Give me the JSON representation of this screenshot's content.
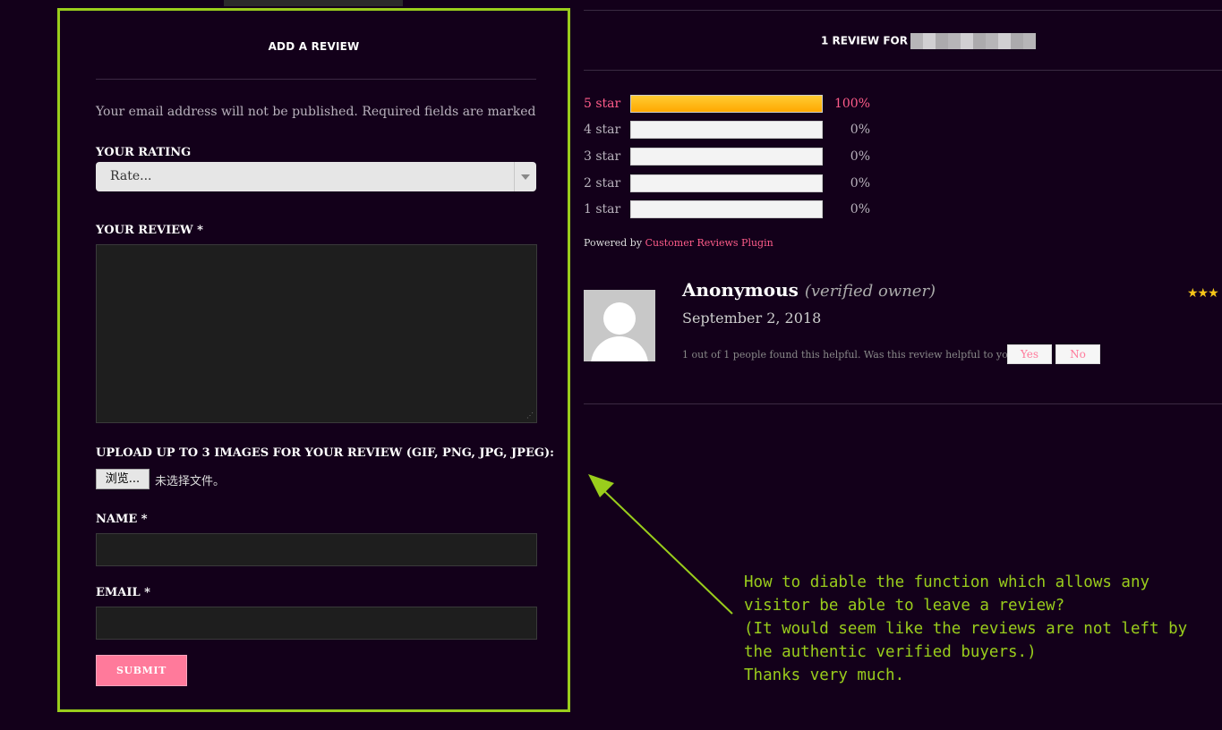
{
  "form": {
    "title": "ADD A REVIEW",
    "note": "Your email address will not be published. Required fields are marked",
    "rating_label": "YOUR RATING",
    "rating_value": "Rate...",
    "review_label": "YOUR REVIEW *",
    "upload_label": "UPLOAD UP TO 3 IMAGES FOR YOUR REVIEW (GIF, PNG, JPG, JPEG):",
    "browse_label": "浏览...",
    "file_status": "未选择文件。",
    "name_label": "NAME *",
    "email_label": "EMAIL *",
    "submit_label": "SUBMIT"
  },
  "summary": {
    "count_text": "1 REVIEW FOR",
    "histogram": [
      {
        "label": "5 star",
        "percent": "100%",
        "fill": 1.0,
        "active": true
      },
      {
        "label": "4 star",
        "percent": "0%",
        "fill": 0.0,
        "active": false
      },
      {
        "label": "3 star",
        "percent": "0%",
        "fill": 0.0,
        "active": false
      },
      {
        "label": "2 star",
        "percent": "0%",
        "fill": 0.0,
        "active": false
      },
      {
        "label": "1 star",
        "percent": "0%",
        "fill": 0.0,
        "active": false
      }
    ],
    "powered_prefix": "Powered by",
    "powered_link": "Customer Reviews Plugin"
  },
  "review": {
    "author": "Anonymous",
    "badge": "(verified owner)",
    "date": "September 2, 2018",
    "helpful_text": "1 out of 1 people found this helpful. Was this review helpful to you?",
    "yes_label": "Yes",
    "no_label": "No",
    "stars_glyph": "★★★"
  },
  "annotation": {
    "text": "How to diable the function which allows any\nvisitor be able to leave a review?\n(It would seem like the reviews are not left by\nthe authentic verified buyers.)\nThanks very much."
  },
  "colors": {
    "background": "#13001a",
    "accent_pink": "#ff5c8a",
    "highlight_green": "#9acd1c",
    "bar_gold": "#ffb000"
  }
}
